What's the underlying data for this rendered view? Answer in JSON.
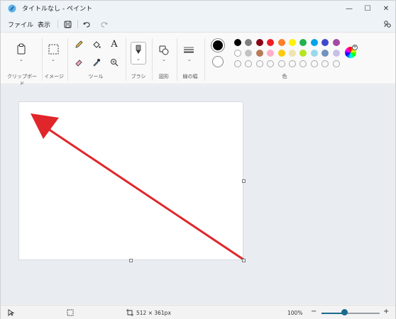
{
  "window": {
    "title": "タイトルなし - ペイント",
    "minimize": "—",
    "maximize": "☐",
    "close": "✕"
  },
  "menu": {
    "file": "ファイル",
    "view": "表示",
    "save_icon": "save-icon",
    "undo_icon": "undo-icon",
    "redo_icon": "redo-icon",
    "share_icon": "share-icon"
  },
  "ribbon": {
    "clipboard": "クリップボード",
    "image": "イメージ",
    "tools": "ツール",
    "brushes": "ブラシ",
    "shapes": "図形",
    "stroke_size": "線の幅",
    "colors": "色",
    "text_tool": "A"
  },
  "palette": {
    "current": [
      "#000000",
      "#ffffff"
    ],
    "row1": [
      "#000000",
      "#7f7f7f",
      "#880015",
      "#ed1c24",
      "#ff7f27",
      "#fff200",
      "#22b14c",
      "#00a2e8",
      "#3f48cc",
      "#a349a4"
    ],
    "row2": [
      "#ffffff",
      "#c3c3c3",
      "#b97a57",
      "#ffaec9",
      "#ffc90e",
      "#efe4b0",
      "#b5e61d",
      "#99d9ea",
      "#7092be",
      "#c8bfe7"
    ],
    "row3_count": 10
  },
  "canvas": {
    "arrow_color": "#e0262b"
  },
  "status": {
    "size": "512 × 361px",
    "zoom": "100%",
    "zoom_minus": "−",
    "zoom_plus": "+",
    "zoom_level": 0.4
  }
}
